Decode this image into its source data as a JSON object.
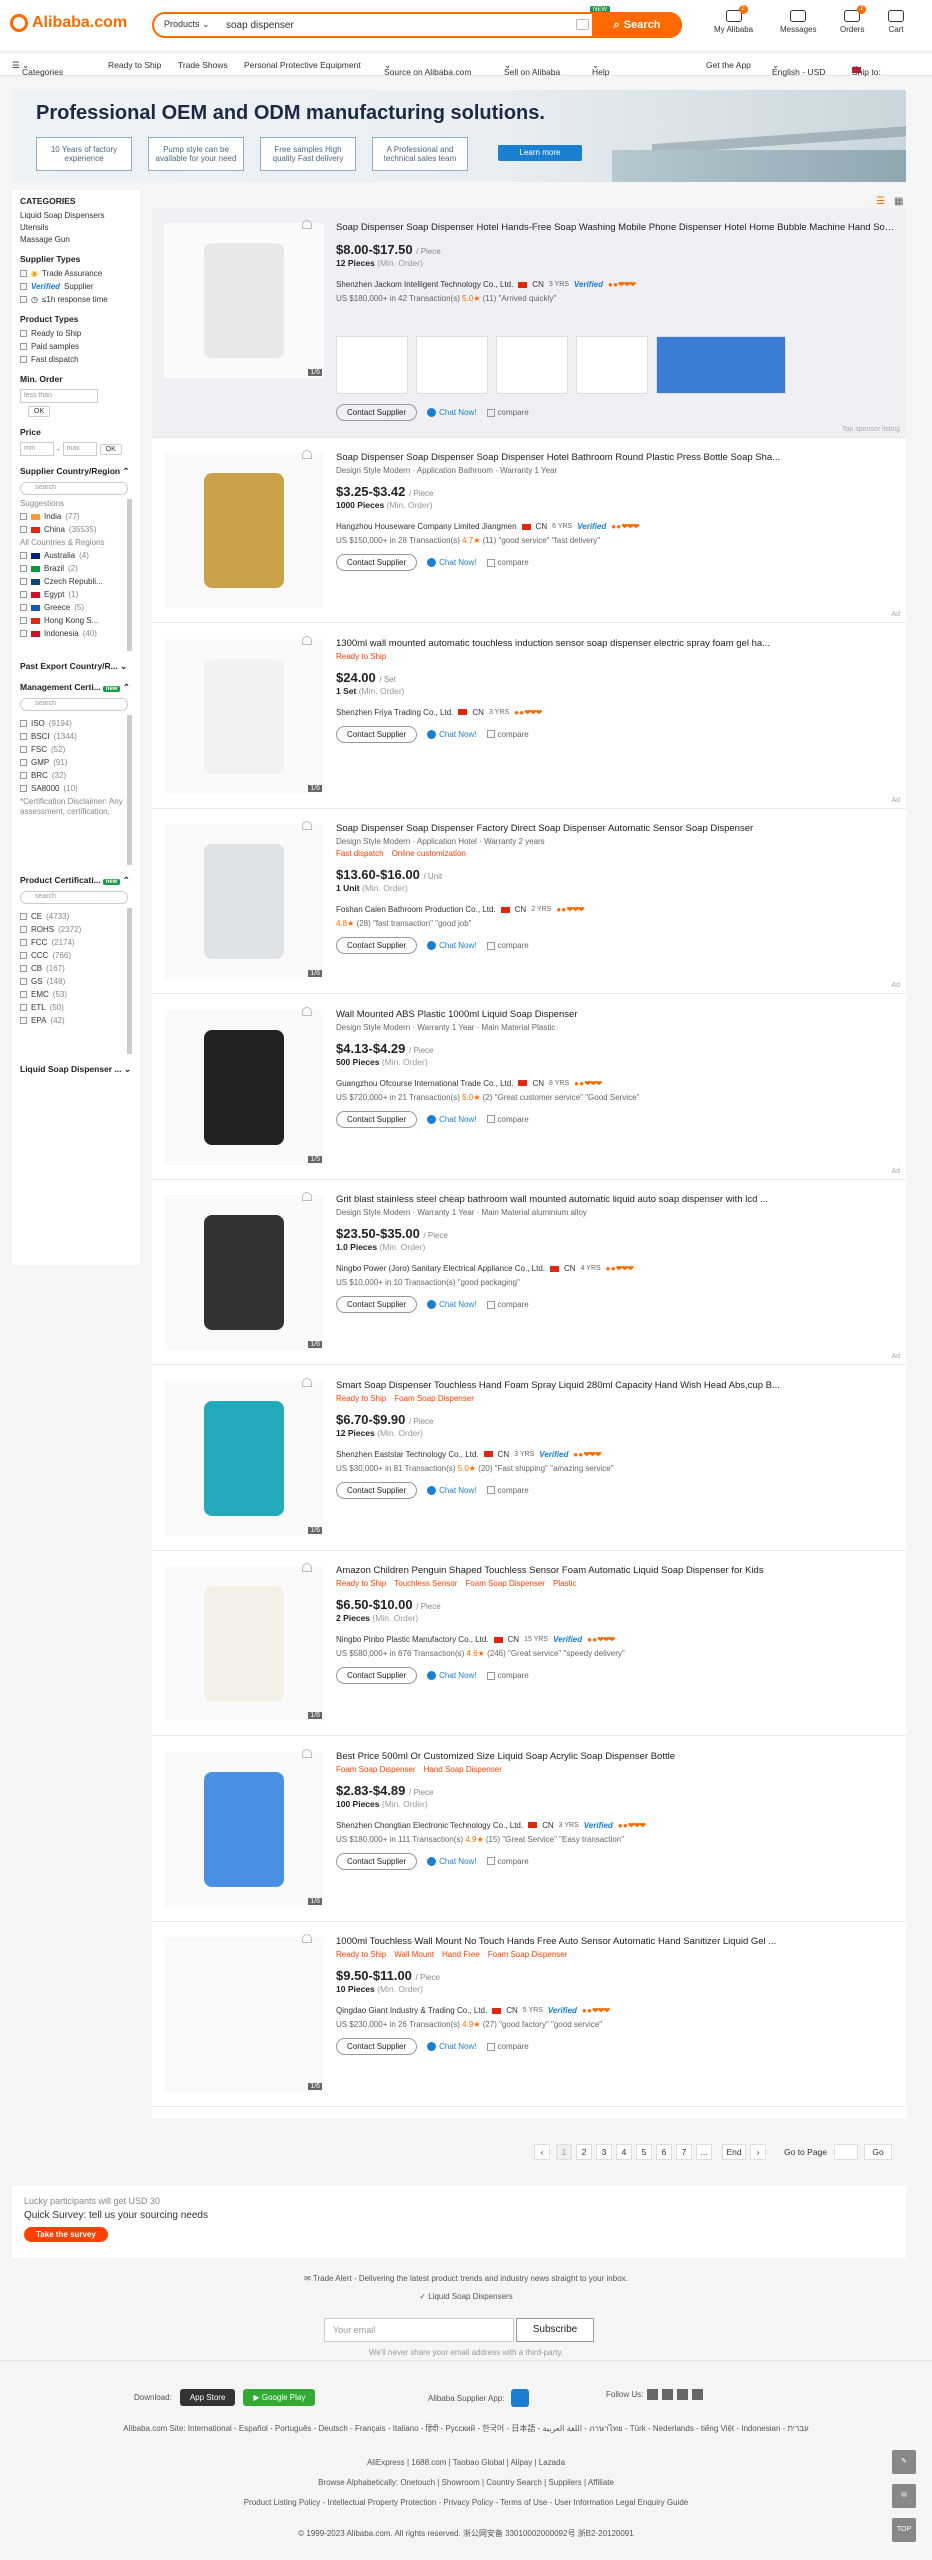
{
  "header": {
    "logo": "Alibaba.com",
    "search_category": "Products",
    "search_query": "soap dispenser",
    "search_button": "Search",
    "new_badge": "NEW",
    "nav": [
      {
        "label": "My Alibaba",
        "badge": "2"
      },
      {
        "label": "Messages",
        "badge": ""
      },
      {
        "label": "Orders",
        "badge": "2"
      },
      {
        "label": "Cart",
        "badge": ""
      }
    ]
  },
  "catbar": {
    "items": [
      "Categories",
      "Ready to Ship",
      "Trade Shows",
      "Personal Protective Equipment",
      "Source on Alibaba.com",
      "Sell on Alibaba",
      "Help"
    ],
    "right": [
      "Get the App",
      "English - USD",
      "Ship to:"
    ]
  },
  "banner": {
    "title": "Professional OEM and ODM manufacturing solutions.",
    "boxes": [
      "10 Years of factory experience",
      "Pump style can be available for your need",
      "Free samples High quality Fast delivery",
      "A Professional and technical sales team"
    ],
    "cta": "Learn more"
  },
  "sidebar": {
    "categories_title": "CATEGORIES",
    "categories": [
      "Liquid Soap Dispensers",
      "Utensils",
      "Massage Gun"
    ],
    "supplier_types_title": "Supplier Types",
    "supplier_types": [
      "Trade Assurance",
      "Supplier",
      "≤1h response time"
    ],
    "product_types_title": "Product Types",
    "product_types": [
      "Ready to Ship",
      "Paid samples",
      "Fast dispatch"
    ],
    "min_order_title": "Min. Order",
    "min_order_placeholder": "less than",
    "ok": "OK",
    "price_title": "Price",
    "price_min": "min",
    "price_max": "max",
    "country_title": "Supplier Country/Region",
    "search": "search",
    "suggestions": "Suggestions",
    "suggested": [
      {
        "name": "India",
        "count": "(77)"
      },
      {
        "name": "China",
        "count": "(35535)"
      }
    ],
    "all_title": "All Countries & Regions",
    "countries": [
      {
        "name": "Australia",
        "count": "(4)"
      },
      {
        "name": "Brazil",
        "count": "(2)"
      },
      {
        "name": "Czech Republi...",
        "count": ""
      },
      {
        "name": "Egypt",
        "count": "(1)"
      },
      {
        "name": "Greece",
        "count": "(5)"
      },
      {
        "name": "Hong Kong S...",
        "count": ""
      },
      {
        "name": "Indonesia",
        "count": "(40)"
      }
    ],
    "past_export": "Past Export Country/R...",
    "mgmt_title": "Management Certi...",
    "new": "new",
    "mgmt": [
      {
        "name": "ISO",
        "count": "(9194)"
      },
      {
        "name": "BSCI",
        "count": "(1344)"
      },
      {
        "name": "FSC",
        "count": "(52)"
      },
      {
        "name": "GMP",
        "count": "(91)"
      },
      {
        "name": "BRC",
        "count": "(32)"
      },
      {
        "name": "SA8000",
        "count": "(10)"
      }
    ],
    "disclaimer": "*Certification Disclaimer: Any assessment, certification,",
    "prodcert_title": "Product Certificati...",
    "prodcert": [
      {
        "name": "CE",
        "count": "(4733)"
      },
      {
        "name": "ROHS",
        "count": "(2372)"
      },
      {
        "name": "FCC",
        "count": "(2174)"
      },
      {
        "name": "CCC",
        "count": "(766)"
      },
      {
        "name": "CB",
        "count": "(167)"
      },
      {
        "name": "GS",
        "count": "(148)"
      },
      {
        "name": "EMC",
        "count": "(53)"
      },
      {
        "name": "ETL",
        "count": "(50)"
      },
      {
        "name": "EPA",
        "count": "(42)"
      }
    ],
    "bottom": "Liquid Soap Dispenser ..."
  },
  "products": [
    {
      "title": "Soap Dispenser Soap Dispenser Hotel Hands-Free Soap Washing Mobile Phone Dispenser Hotel Home Bubble Machine Hand Soap Di...",
      "attrs": "",
      "tags": [],
      "price": "$8.00-$17.50",
      "unit": "/ Piece",
      "moq": "12 Pieces",
      "supplier": "Shenzhen Jackom Intelligent Technology Co., Ltd.",
      "country": "CN",
      "yrs": "3 YRS",
      "verified": "Verified",
      "meta_pre": "US $180,000+ in 42 Transaction(s)",
      "score": "5.0",
      "reviews": "(11) \"Arrived quickly\"",
      "sponsor": "Top sponsor listing",
      "photo": "1/6"
    },
    {
      "title": "Soap Dispenser Soap Dispenser Soap Dispenser Hotel Bathroom Round Plastic Press Bottle Soap Sha...",
      "attrs": "Design Style Modern · Application Bathroom · Warranty 1 Year",
      "tags": [],
      "price": "$3.25-$3.42",
      "unit": "/ Piece",
      "moq": "1000 Pieces",
      "supplier": "Hangzhou Houseware Company Limited Jiangmen",
      "country": "CN",
      "yrs": "6 YRS",
      "verified": "Verified",
      "meta_pre": "US $150,000+ in 28 Transaction(s)",
      "score": "4.7",
      "reviews": "(11) \"good service\" \"fast delivery\"",
      "sponsor": "Ad",
      "photo": ""
    },
    {
      "title": "1300ml wall mounted automatic touchless induction sensor soap dispenser electric spray foam gel ha...",
      "attrs": "",
      "tags": [
        "Ready to Ship"
      ],
      "price": "$24.00",
      "unit": "/ Set",
      "moq": "1 Set",
      "supplier": "Shenzhen Friya Trading Co., Ltd.",
      "country": "CN",
      "yrs": "3 YRS",
      "verified": "",
      "meta_pre": "",
      "score": "",
      "reviews": "",
      "sponsor": "Ad",
      "photo": "1/6"
    },
    {
      "title": "Soap Dispenser Soap Dispenser Factory Direct Soap Dispenser Automatic Sensor Soap Dispenser",
      "attrs": "Design Style Modern · Application Hotel · Warranty 2 years",
      "tags": [
        "Fast dispatch",
        "Online customization"
      ],
      "price": "$13.60-$16.00",
      "unit": "/ Unit",
      "moq": "1 Unit",
      "supplier": "Foshan Caien Bathroom Production Co., Ltd.",
      "country": "CN",
      "yrs": "2 YRS",
      "verified": "",
      "meta_pre": "",
      "score": "4.8",
      "reviews": "(28) \"fast transaction\" \"good job\"",
      "sponsor": "Ad",
      "photo": "1/6"
    },
    {
      "title": "Wall Mounted ABS Plastic 1000ml Liquid Soap Dispenser",
      "attrs": "Design Style Modern · Warranty 1 Year · Main Material Plastic",
      "tags": [],
      "price": "$4.13-$4.29",
      "unit": "/ Piece",
      "moq": "500 Pieces",
      "supplier": "Guangzhou Ofcourse International Trade Co., Ltd.",
      "country": "CN",
      "yrs": "8 YRS",
      "verified": "",
      "meta_pre": "US $720,000+ in 21 Transaction(s)",
      "score": "5.0",
      "reviews": "(2) \"Great customer service\" \"Good Service\"",
      "sponsor": "Ad",
      "photo": "1/5"
    },
    {
      "title": "Grit blast stainless steel cheap bathroom wall mounted automatic liquid auto soap dispenser with lcd ...",
      "attrs": "Design Style Modern · Warranty 1 Year · Main Material aluminium alloy",
      "tags": [],
      "price": "$23.50-$35.00",
      "unit": "/ Piece",
      "moq": "1.0 Pieces",
      "supplier": "Ningbo Power (Joro) Sanitary Electrical Appliance Co., Ltd.",
      "country": "CN",
      "yrs": "4 YRS",
      "verified": "",
      "meta_pre": "US $10,000+ in 10 Transaction(s)",
      "score": "",
      "reviews": "\"good packaging\"",
      "sponsor": "Ad",
      "photo": "1/6"
    },
    {
      "title": "Smart Soap Dispenser Touchless Hand Foam Spray Liquid 280ml Capacity Hand Wish Head Abs,cup B...",
      "attrs": "",
      "tags": [
        "Ready to Ship",
        "Foam Soap Dispenser"
      ],
      "price": "$6.70-$9.90",
      "unit": "/ Piece",
      "moq": "12 Pieces",
      "supplier": "Shenzhen Eaststar Technology Co., Ltd.",
      "country": "CN",
      "yrs": "3 YRS",
      "verified": "Verified",
      "meta_pre": "US $30,000+ in 81 Transaction(s)",
      "score": "5.0",
      "reviews": "(20) \"Fast shipping\" \"amazing service\"",
      "sponsor": "",
      "photo": "1/6"
    },
    {
      "title": "Amazon Children Penguin Shaped Touchless Sensor Foam Automatic Liquid Soap Dispenser for Kids",
      "attrs": "",
      "tags": [
        "Ready to Ship",
        "Touchless Sensor",
        "Foam Soap Dispenser",
        "Plastic"
      ],
      "price": "$6.50-$10.00",
      "unit": "/ Piece",
      "moq": "2 Pieces",
      "supplier": "Ningbo Pinbo Plastic Manufactory Co., Ltd.",
      "country": "CN",
      "yrs": "15 YRS",
      "verified": "Verified",
      "meta_pre": "US $580,000+ in 676 Transaction(s)",
      "score": "4.6",
      "reviews": "(246) \"Great service\" \"speedy delivery\"",
      "sponsor": "",
      "photo": "1/6"
    },
    {
      "title": "Best Price 500ml Or Customized Size Liquid Soap Acrylic Soap Dispenser Bottle",
      "attrs": "",
      "tags": [
        "Foam Soap Dispenser",
        "Hand Soap Dispenser"
      ],
      "price": "$2.83-$4.89",
      "unit": "/ Piece",
      "moq": "100 Pieces",
      "supplier": "Shenzhen Chongtian Electronic Technology Co., Ltd.",
      "country": "CN",
      "yrs": "3 YRS",
      "verified": "Verified",
      "meta_pre": "US $180,000+ in 111 Transaction(s)",
      "score": "4.9",
      "reviews": "(15) \"Great Service\" \"Easy transaction\"",
      "sponsor": "",
      "photo": "1/6"
    },
    {
      "title": "1000ml Touchless Wall Mount No Touch Hands Free Auto Sensor Automatic Hand Sanitizer Liquid Gel ...",
      "attrs": "",
      "tags": [
        "Ready to Ship",
        "Wall Mount",
        "Hand Free",
        "Foam Soap Dispenser"
      ],
      "price": "$9.50-$11.00",
      "unit": "/ Piece",
      "moq": "10 Pieces",
      "supplier": "Qingdao Giant Industry & Trading Co., Ltd.",
      "country": "CN",
      "yrs": "5 YRS",
      "verified": "Verified",
      "meta_pre": "US $230,000+ in 26 Transaction(s)",
      "score": "4.9",
      "reviews": "(27) \"good factory\" \"good service\"",
      "sponsor": "",
      "photo": "1/6"
    }
  ],
  "common": {
    "contact": "Contact Supplier",
    "chat": "Chat Now!",
    "compare": "compare",
    "min_order": "(Min. Order)"
  },
  "pager": {
    "pages": [
      "1",
      "2",
      "3",
      "4",
      "5",
      "6",
      "7",
      "...",
      "End"
    ],
    "goto": "Go to Page",
    "go": "Go"
  },
  "survey": {
    "line1": "Lucky participants will get USD 30",
    "line2": "Quick Survey: tell us your sourcing needs",
    "button": "Take the survey"
  },
  "footer": {
    "alert": "Trade Alert - Delivering the latest product trends and industry news straight to your inbox.",
    "alert_item": "Liquid Soap Dispensers",
    "email_placeholder": "Your email",
    "subscribe": "Subscribe",
    "privacy": "We'll never share your email address with a third-party.",
    "download": "Download:",
    "appstore": "App Store",
    "googleplay": "Google Play",
    "supplier_app": "Alibaba Supplier App:",
    "follow": "Follow Us:",
    "sites": "Alibaba.com Site: International - Español - Português - Deutsch - Français - Italiano - हिंदी - Pусский - 한국어 - 日本語 - اللغة العربية - ภาษาไทย - Türk - Nederlands - tiếng Việt - Indonesian - עברית",
    "links1": "AliExpress | 1688.com | Taobao Global | Alipay | Lazada",
    "links2": "Browse Alphabetically: Onetouch | Showroom | Country Search | Suppliers | Affiliate",
    "links3": "Product Listing Policy - Intellectual Property Protection - Privacy Policy - Terms of Use - User Information Legal Enquiry Guide",
    "copyright": "© 1999-2023 Alibaba.com. All rights reserved.   浙公网安备 33010002000092号   浙B2-20120091"
  },
  "colors": {
    "brand": "#ff6a00",
    "link": "#1a7fd0"
  }
}
